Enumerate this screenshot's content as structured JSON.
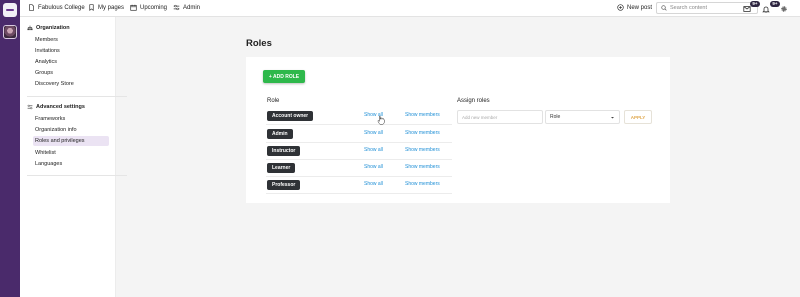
{
  "topbar": {
    "nav": [
      {
        "label": "Fabulous College",
        "icon": "document-icon"
      },
      {
        "label": "My pages",
        "icon": "bookmark-icon"
      },
      {
        "label": "Upcoming",
        "icon": "calendar-icon"
      },
      {
        "label": "Admin",
        "icon": "sliders-icon"
      }
    ],
    "new_post_label": "New post",
    "search_placeholder": "Search content",
    "mail_badge": "9+",
    "bell_badge": "9+"
  },
  "sidebar": {
    "organization_title": "Organization",
    "organization_items": [
      "Members",
      "Invitations",
      "Analytics",
      "Groups",
      "Discovery Store"
    ],
    "advanced_title": "Advanced settings",
    "advanced_items": [
      "Frameworks",
      "Organization info",
      "Roles and privileges",
      "Whitelist",
      "Languages"
    ],
    "active_item": "Roles and privileges"
  },
  "main": {
    "title": "Roles",
    "add_role_label": "+ ADD ROLE",
    "role_column_label": "Role",
    "assign_roles_label": "Assign roles",
    "show_all_label": "Show all",
    "show_members_label": "Show members",
    "roles": [
      "Account owner",
      "Admin",
      "Instructor",
      "Learner",
      "Professor"
    ],
    "assign_input_placeholder": "Add new member",
    "assign_select_value": "Role",
    "apply_label": "APPLY"
  },
  "colors": {
    "rail": "#4a2a6b",
    "add_role_green": "#2eb84b",
    "link_blue": "#1f8fd6",
    "apply_orange": "#e0a94f",
    "active_item_bg": "#ebe3f3"
  }
}
